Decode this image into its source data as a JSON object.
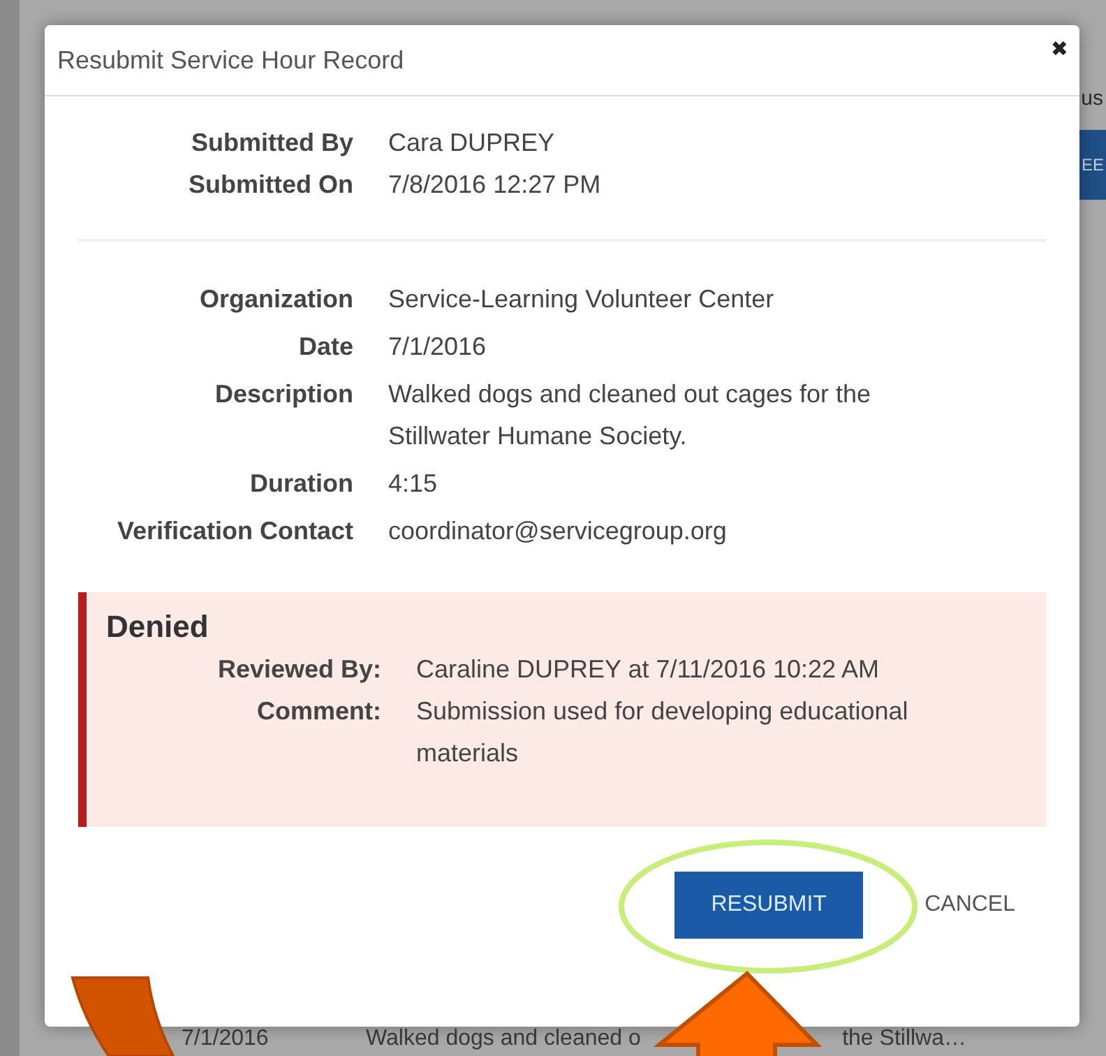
{
  "background": {
    "heading_fragment": "us",
    "button_fragment": "EE",
    "row": {
      "date": "7/1/2016",
      "description_parts": [
        "Walked dogs and cleaned o",
        "the Stillwa…"
      ]
    }
  },
  "dialog": {
    "title": "Resubmit Service Hour Record",
    "close": "✖",
    "submission": [
      {
        "label": "Submitted By",
        "value": "Cara DUPREY"
      },
      {
        "label": "Submitted On",
        "value": "7/8/2016 12:27 PM"
      }
    ],
    "details": [
      {
        "label": "Organization",
        "value": "Service-Learning Volunteer Center"
      },
      {
        "label": "Date",
        "value": "7/1/2016"
      },
      {
        "label": "Description",
        "value": "Walked dogs and cleaned out cages for the Stillwater Humane Society."
      },
      {
        "label": "Duration",
        "value": "4:15"
      },
      {
        "label": "Verification Contact",
        "value": "coordinator@servicegroup.org"
      }
    ],
    "review": {
      "status": "Denied",
      "fields": [
        {
          "label": "Reviewed By:",
          "value": "Caraline DUPREY at 7/11/2016 10:22 AM"
        },
        {
          "label": "Comment:",
          "value": "Submission used for developing educational materials"
        }
      ]
    },
    "buttons": [
      {
        "label": "RESUBMIT",
        "kind": "primary"
      },
      {
        "label": "CANCEL",
        "kind": "link"
      }
    ]
  }
}
